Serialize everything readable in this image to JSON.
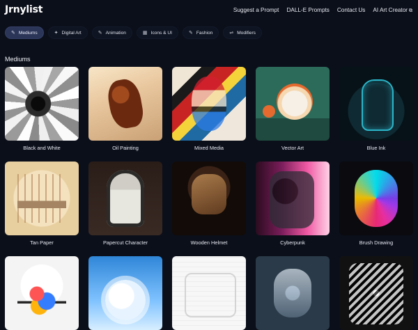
{
  "header": {
    "logo": "Jrnylist",
    "nav": [
      {
        "label": "Suggest a Prompt"
      },
      {
        "label": "DALL-E Prompts"
      },
      {
        "label": "Contact Us"
      },
      {
        "label": "AI Art Creator"
      }
    ]
  },
  "tabs": [
    {
      "label": "Mediums",
      "icon": "brush-icon",
      "active": true
    },
    {
      "label": "Digital Art",
      "icon": "digital-art-icon",
      "active": false
    },
    {
      "label": "Animation",
      "icon": "animation-icon",
      "active": false
    },
    {
      "label": "Icons & UI",
      "icon": "grid-icon",
      "active": false
    },
    {
      "label": "Fashion",
      "icon": "tag-icon",
      "active": false
    },
    {
      "label": "Modifiers",
      "icon": "sliders-icon",
      "active": false
    }
  ],
  "section": {
    "title": "Mediums"
  },
  "cards": [
    {
      "label": "Black and White"
    },
    {
      "label": "Oil Painting"
    },
    {
      "label": "Mixed Media"
    },
    {
      "label": "Vector Art"
    },
    {
      "label": "Blue Ink"
    },
    {
      "label": "Tan Paper"
    },
    {
      "label": "Papercut Character"
    },
    {
      "label": "Wooden Helmet"
    },
    {
      "label": "Cyberpunk"
    },
    {
      "label": "Brush Drawing"
    }
  ],
  "colors": {
    "background": "#0b0f1a",
    "tab_active": "#2b3557"
  }
}
